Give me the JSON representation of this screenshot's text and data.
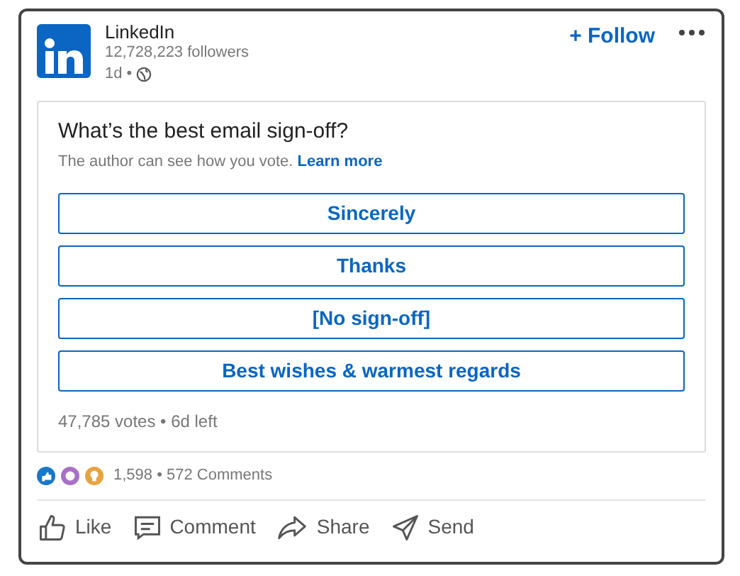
{
  "author": {
    "name": "LinkedIn",
    "followers": "12,728,223 followers",
    "time": "1d •"
  },
  "follow": "+ Follow",
  "poll": {
    "question": "What’s the best email sign-off?",
    "note": "The author can see how you vote.",
    "learn_more": "Learn more",
    "options": [
      {
        "label": "Sincerely"
      },
      {
        "label": "Thanks"
      },
      {
        "label": "[No sign-off]"
      },
      {
        "label": "Best wishes & warmest regards"
      }
    ],
    "footer": "47,785 votes • 6d left"
  },
  "social": {
    "counts": "1,598 • 572 Comments"
  },
  "actions": [
    {
      "kind": "like",
      "label": "Like"
    },
    {
      "kind": "comment",
      "label": "Comment"
    },
    {
      "kind": "share",
      "label": "Share"
    },
    {
      "kind": "send",
      "label": "Send"
    }
  ]
}
